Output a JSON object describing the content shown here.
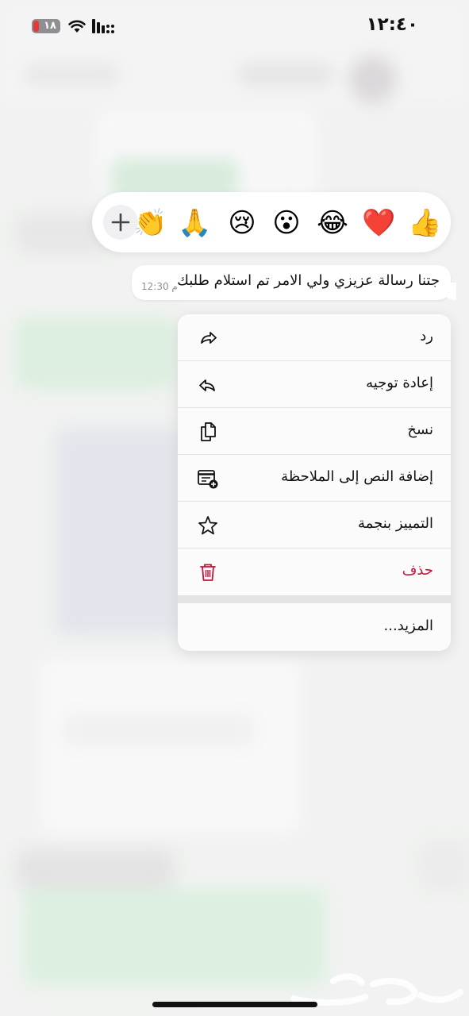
{
  "status_bar": {
    "time": "١٢:٤٠",
    "battery_level": "١٨"
  },
  "reactions": {
    "emojis": [
      {
        "name": "thumbs-up",
        "glyph": "👍"
      },
      {
        "name": "red-heart",
        "glyph": "❤️"
      },
      {
        "name": "laughing-tears",
        "glyph": "😂"
      },
      {
        "name": "surprised",
        "glyph": "😮"
      },
      {
        "name": "crying",
        "glyph": "😢"
      },
      {
        "name": "folded-hands",
        "glyph": "🙏"
      },
      {
        "name": "clapping-hands",
        "glyph": "👏"
      }
    ]
  },
  "message": {
    "text": "جتنا رسالة عزيزي ولي الامر تم استلام طلبك",
    "time": "12:30 م"
  },
  "menu": {
    "items": [
      {
        "label": "رد",
        "icon": "reply-icon"
      },
      {
        "label": "إعادة توجيه",
        "icon": "forward-icon"
      },
      {
        "label": "نسخ",
        "icon": "copy-icon"
      },
      {
        "label": "إضافة النص إلى الملاحظة",
        "icon": "add-note-icon"
      },
      {
        "label": "التمييز بنجمة",
        "icon": "star-icon"
      },
      {
        "label": "حذف",
        "icon": "trash-icon"
      }
    ],
    "more_label": "المزيد..."
  },
  "colors": {
    "delete": "#c4153a",
    "menu_bg": "#fbfbfb",
    "battery_low": "#e53935"
  }
}
